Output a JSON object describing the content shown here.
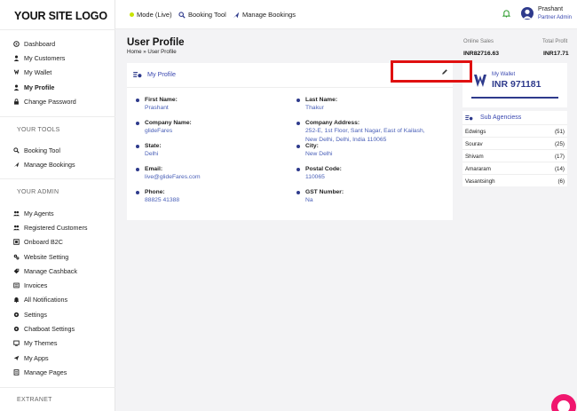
{
  "app": {
    "logo": "YOUR SITE LOGO"
  },
  "sidebar": {
    "main": [
      {
        "label": "Dashboard",
        "icon": "dashboard-icon"
      },
      {
        "label": "My Customers",
        "icon": "user-icon"
      },
      {
        "label": "My Wallet",
        "icon": "wallet-icon"
      },
      {
        "label": "My Profile",
        "icon": "user-icon",
        "active": true
      },
      {
        "label": "Change Password",
        "icon": "lock-icon"
      }
    ],
    "tools_title": "YOUR TOOLS",
    "tools": [
      {
        "label": "Booking Tool",
        "icon": "search-icon"
      },
      {
        "label": "Manage Bookings",
        "icon": "plane-icon"
      }
    ],
    "admin_title": "YOUR ADMIN",
    "admin": [
      {
        "label": "My Agents",
        "icon": "users-icon"
      },
      {
        "label": "Registered Customers",
        "icon": "users-icon"
      },
      {
        "label": "Onboard B2C",
        "icon": "onboard-icon"
      },
      {
        "label": "Website Setting",
        "icon": "gears-icon"
      },
      {
        "label": "Manage Cashback",
        "icon": "cashback-icon"
      },
      {
        "label": "Invoices",
        "icon": "invoice-icon"
      },
      {
        "label": "All Notifications",
        "icon": "bell-icon"
      },
      {
        "label": "Settings",
        "icon": "gear-icon"
      },
      {
        "label": "Chatboat Settings",
        "icon": "chat-gear-icon"
      },
      {
        "label": "My Themes",
        "icon": "theme-icon"
      },
      {
        "label": "My Apps",
        "icon": "send-icon"
      },
      {
        "label": "Manage Pages",
        "icon": "pages-icon"
      }
    ],
    "extranet_title": "EXTRANET"
  },
  "topbar": {
    "mode": "Mode (Live)",
    "booking_tool": "Booking Tool",
    "manage_bookings": "Manage Bookings",
    "user_name": "Prashant",
    "user_role": "Partner Admin"
  },
  "page": {
    "title": "User Profile",
    "breadcrumb": "Home » User Profile"
  },
  "stats": {
    "online_sales_label": "Online Sales",
    "online_sales_value": "INR82716.63",
    "total_profit_label": "Total Profit",
    "total_profit_value": "INR17.71"
  },
  "profile": {
    "heading": "My Profile",
    "fields": {
      "first_name": {
        "label": "First Name:",
        "value": "Prashant"
      },
      "last_name": {
        "label": "Last Name:",
        "value": "Thakur"
      },
      "company_name": {
        "label": "Company Name:",
        "value": "glideFares"
      },
      "company_address": {
        "label": "Company Address:",
        "value_line1": "252-E, 1st Floor, Sant Nagar, East of Kailash,",
        "value_line2": "New Delhi, Delhi, India 110065"
      },
      "state": {
        "label": "State:",
        "value": "Delhi"
      },
      "city": {
        "label": "City:",
        "value": "New Delhi"
      },
      "email": {
        "label": "Email:",
        "value": "live@glideFares.com"
      },
      "postal_code": {
        "label": "Postal Code:",
        "value": "110065"
      },
      "phone": {
        "label": "Phone:",
        "value": "88825 41388"
      },
      "gst": {
        "label": "GST Number:",
        "value": "Na"
      }
    }
  },
  "wallet": {
    "label": "My Wallet",
    "amount": "INR 971181"
  },
  "sub_agencies": {
    "title": "Sub Agenciess",
    "rows": [
      {
        "name": "Edwings",
        "count": "(51)"
      },
      {
        "name": "Sourav",
        "count": "(25)"
      },
      {
        "name": "Shivam",
        "count": "(17)"
      },
      {
        "name": "Amararam",
        "count": "(14)"
      },
      {
        "name": "Vasantsingh",
        "count": "(6)"
      }
    ]
  },
  "colors": {
    "accent": "#2e3a8c",
    "link": "#4a60b8",
    "highlight": "#e01010",
    "chat": "#f0166e"
  }
}
